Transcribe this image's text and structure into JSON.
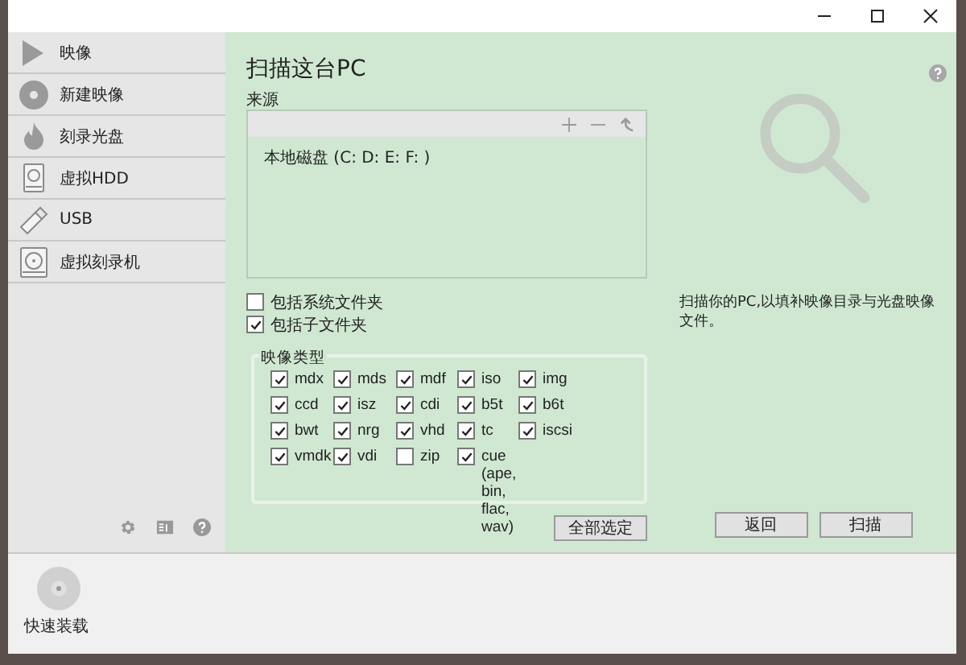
{
  "sidebar": {
    "items": [
      {
        "label": "映像",
        "selected": false
      },
      {
        "label": "新建映像",
        "selected": false
      },
      {
        "label": "刻录光盘",
        "selected": false
      },
      {
        "label": "虚拟HDD",
        "selected": false
      },
      {
        "label": "USB",
        "selected": false
      },
      {
        "label": "虚拟刻录机",
        "selected": false
      }
    ]
  },
  "main": {
    "title": "扫描这台PC",
    "source": {
      "label": "来源",
      "items": [
        "本地磁盘 (C: D: E: F: )"
      ]
    },
    "options": [
      {
        "label": "包括系统文件夹",
        "checked": false
      },
      {
        "label": "包括子文件夹",
        "checked": true
      }
    ],
    "image_types": {
      "label": "映像类型",
      "items": [
        {
          "label": "mdx",
          "checked": true
        },
        {
          "label": "mds",
          "checked": true
        },
        {
          "label": "mdf",
          "checked": true
        },
        {
          "label": "iso",
          "checked": true
        },
        {
          "label": "img",
          "checked": true
        },
        {
          "label": "ccd",
          "checked": true
        },
        {
          "label": "isz",
          "checked": true
        },
        {
          "label": "cdi",
          "checked": true
        },
        {
          "label": "b5t",
          "checked": true
        },
        {
          "label": "b6t",
          "checked": true
        },
        {
          "label": "bwt",
          "checked": true
        },
        {
          "label": "nrg",
          "checked": true
        },
        {
          "label": "vhd",
          "checked": true
        },
        {
          "label": "tc",
          "checked": true
        },
        {
          "label": "iscsi",
          "checked": true
        },
        {
          "label": "vmdk",
          "checked": true
        },
        {
          "label": "vdi",
          "checked": true
        },
        {
          "label": "zip",
          "checked": false
        },
        {
          "label": "cue (ape, bin, flac, wav)",
          "checked": true
        }
      ]
    },
    "select_all": "全部选定",
    "hint": "扫描你的PC,以填补映像目录与光盘映像文件。",
    "buttons": [
      "返回",
      "扫描"
    ]
  },
  "quick_mount": {
    "label": "快速装载"
  }
}
